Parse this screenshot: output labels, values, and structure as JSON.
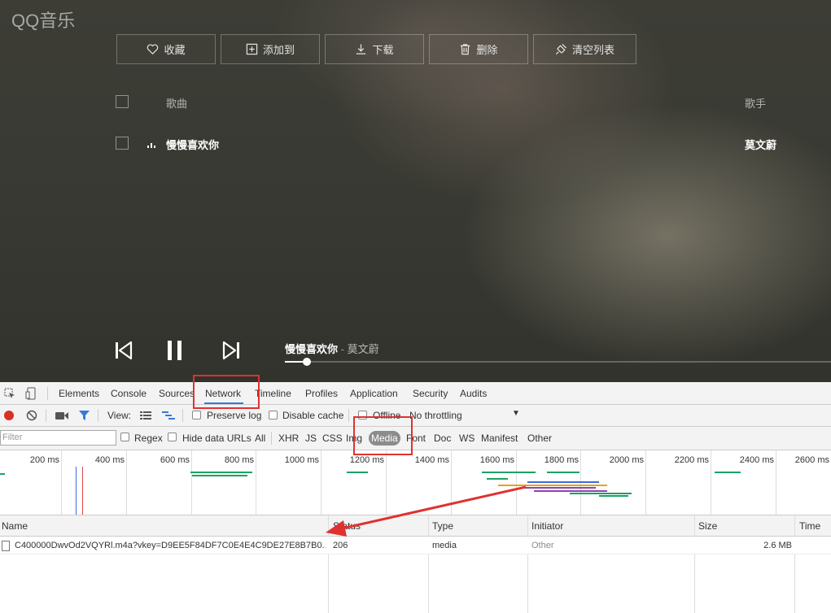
{
  "app": {
    "logo": "QQ音乐"
  },
  "toolbar": {
    "favorite": "收藏",
    "add_to": "添加到",
    "download": "下载",
    "delete": "删除",
    "clear_list": "清空列表"
  },
  "song_list": {
    "header_song": "歌曲",
    "header_singer": "歌手",
    "rows": [
      {
        "song": "慢慢喜欢你",
        "singer": "莫文蔚"
      }
    ]
  },
  "now_playing": {
    "title": "慢慢喜欢你",
    "separator": " - ",
    "artist": "莫文蔚",
    "progress": 0.04
  },
  "devtools": {
    "tabs": [
      "Elements",
      "Console",
      "Sources",
      "Network",
      "Timeline",
      "Profiles",
      "Application",
      "Security",
      "Audits"
    ],
    "active_tab": "Network",
    "view_label": "View:",
    "preserve_log": "Preserve log",
    "disable_cache": "Disable cache",
    "offline": "Offline",
    "throttling": "No throttling",
    "filter_placeholder": "Filter",
    "regex": "Regex",
    "hide_data_urls": "Hide data URLs",
    "types": [
      "All",
      "XHR",
      "JS",
      "CSS",
      "Img",
      "Media",
      "Font",
      "Doc",
      "WS",
      "Manifest",
      "Other"
    ],
    "active_type": "Media",
    "timeline_ticks": [
      "200 ms",
      "400 ms",
      "600 ms",
      "800 ms",
      "1000 ms",
      "1200 ms",
      "1400 ms",
      "1600 ms",
      "1800 ms",
      "2000 ms",
      "2200 ms",
      "2400 ms",
      "2600 ms"
    ],
    "columns": [
      "Name",
      "Status",
      "Type",
      "Initiator",
      "Size",
      "Time"
    ],
    "requests": [
      {
        "name": "C400000DwvOd2VQYRl.m4a?vkey=D9EE5F84DF7C0E4E4C9DE27E8B7B0...",
        "status": "206",
        "type": "media",
        "initiator": "Other",
        "size": "2.6 MB",
        "time": ""
      }
    ],
    "colors": {
      "accent": "#3879d9",
      "annotation": "#e03131",
      "record": "#d93025"
    }
  }
}
